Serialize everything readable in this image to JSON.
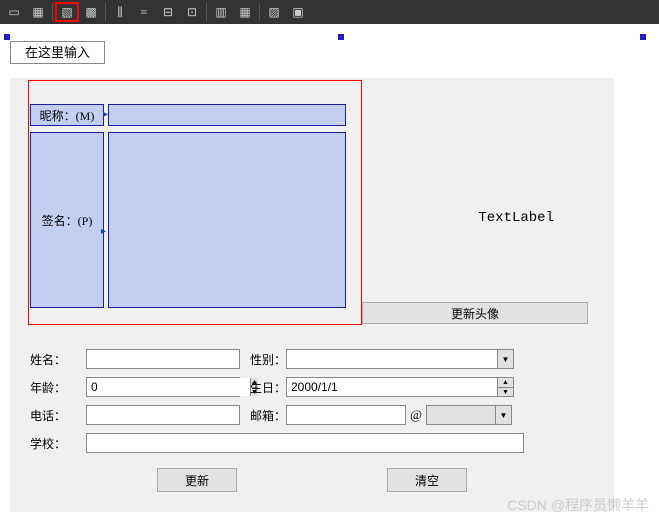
{
  "tab_label": "在这里输入",
  "nickname_label": "昵称：(M)",
  "signature_label": "签名：(P)",
  "text_label": "TextLabel",
  "avatar_button": "更新头像",
  "labels": {
    "name": "姓名：",
    "gender": "性别：",
    "age": "年龄：",
    "birthday": "生日：",
    "phone": "电话：",
    "email": "邮箱：",
    "school": "学校："
  },
  "values": {
    "age": "0",
    "birthday": "2000/1/1",
    "at": "@"
  },
  "buttons": {
    "update": "更新",
    "clear": "清空"
  },
  "watermark": "CSDN @程序员懒羊羊"
}
